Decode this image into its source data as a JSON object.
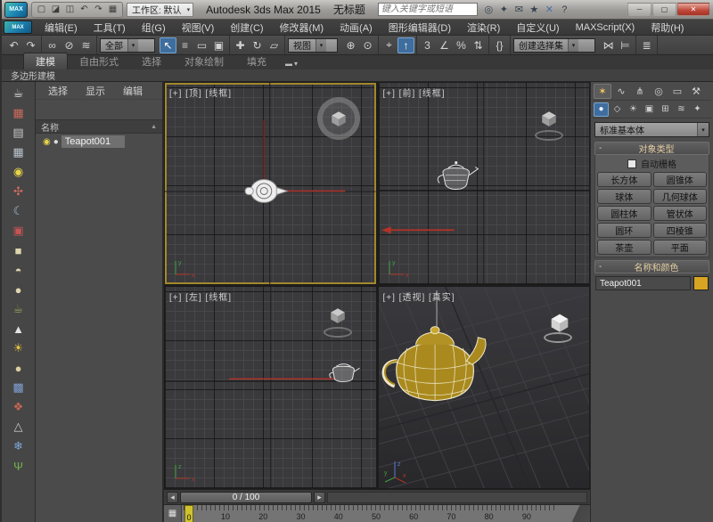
{
  "colors": {
    "accent_blue": "#3f6e9e",
    "active_viewport_border": "#a3872c",
    "teapot_gold": "#aa8a1e",
    "marker_yellow": "#cfc22e"
  },
  "glyphs": {
    "dropdown_arrow": "▾",
    "sort_asc": "▲",
    "slider_prev": "◂",
    "slider_next": "▸",
    "rollout_collapse": "-",
    "curve_editor": "▦",
    "ribbon_pill": "▬",
    "max_logo": "MAX",
    "strip_scroll": "▾",
    "minimize": "─",
    "maximize": "▢",
    "close": "✕"
  },
  "titlebar": {
    "workspace_label": "工作区: 默认",
    "app_title": "Autodesk 3ds Max  2015",
    "doc_title": "无标题",
    "search_placeholder": "键入关键字或短语",
    "qat": [
      {
        "name": "new-scene-icon",
        "glyph": "▢"
      },
      {
        "name": "open-file-icon",
        "glyph": "◪"
      },
      {
        "name": "save-file-icon",
        "glyph": "◫"
      },
      {
        "name": "undo-icon",
        "glyph": "↶"
      },
      {
        "name": "redo-icon",
        "glyph": "↷"
      },
      {
        "name": "project-folder-icon",
        "glyph": "▦"
      }
    ],
    "utility_icons": [
      {
        "name": "search-icon",
        "glyph": "◎"
      },
      {
        "name": "sign-in-key-icon",
        "glyph": "✦"
      },
      {
        "name": "communication-center-icon",
        "glyph": "✉"
      },
      {
        "name": "favorites-star-icon",
        "glyph": "★"
      },
      {
        "name": "a360-icon",
        "glyph": "✕",
        "color": "#4a6ea8"
      },
      {
        "name": "help-icon",
        "glyph": "?"
      }
    ]
  },
  "menubar": [
    "编辑(E)",
    "工具(T)",
    "组(G)",
    "视图(V)",
    "创建(C)",
    "修改器(M)",
    "动画(A)",
    "图形编辑器(D)",
    "渲染(R)",
    "自定义(U)",
    "MAXScript(X)",
    "帮助(H)"
  ],
  "toolbar": {
    "filter_value": "全部",
    "ref_value": "视图",
    "sets_value": "创建选择集",
    "g1": [
      {
        "name": "undo-icon",
        "glyph": "↶"
      },
      {
        "name": "redo-icon",
        "glyph": "↷"
      }
    ],
    "g2": [
      {
        "name": "select-and-link-icon",
        "glyph": "∞"
      },
      {
        "name": "unlink-selection-icon",
        "glyph": "⊘"
      },
      {
        "name": "bind-to-space-warp-icon",
        "glyph": "≋"
      }
    ],
    "g3": [
      {
        "name": "select-object-icon",
        "glyph": "↖",
        "active": true
      },
      {
        "name": "select-by-name-icon",
        "glyph": "≡"
      },
      {
        "name": "rectangular-selection-region-icon",
        "glyph": "▭"
      },
      {
        "name": "window-crossing-icon",
        "glyph": "▣"
      }
    ],
    "g4": [
      {
        "name": "select-and-move-icon",
        "glyph": "✚"
      },
      {
        "name": "select-and-rotate-icon",
        "glyph": "↻"
      },
      {
        "name": "select-and-scale-icon",
        "glyph": "▱"
      }
    ],
    "g5": [
      {
        "name": "use-pivot-point-icon",
        "glyph": "⊕"
      },
      {
        "name": "use-selection-center-icon",
        "glyph": "⊙"
      }
    ],
    "g6": [
      {
        "name": "select-and-manipulate-icon",
        "glyph": "⌖"
      },
      {
        "name": "keyboard-shortcut-override-icon",
        "glyph": "↑",
        "active": true
      }
    ],
    "g7": [
      {
        "name": "snap-toggle-3d-icon",
        "glyph": "3"
      },
      {
        "name": "angle-snap-icon",
        "glyph": "∠"
      },
      {
        "name": "percent-snap-icon",
        "glyph": "%"
      },
      {
        "name": "spinner-snap-icon",
        "glyph": "⇅"
      }
    ],
    "g8": [
      {
        "name": "edit-named-selection-sets-icon",
        "glyph": "{}"
      }
    ],
    "g9": [
      {
        "name": "mirror-icon",
        "glyph": "⋈"
      },
      {
        "name": "align-icon",
        "glyph": "⊨"
      }
    ],
    "g10": [
      {
        "name": "layer-manager-icon",
        "glyph": "≣"
      }
    ]
  },
  "ribbon": {
    "tabs": [
      {
        "label": "建模",
        "active": true
      },
      {
        "label": "自由形式"
      },
      {
        "label": "选择"
      },
      {
        "label": "对象绘制"
      },
      {
        "label": "填充"
      }
    ],
    "panel_label": "多边形建模"
  },
  "left_strip": {
    "icons": [
      {
        "name": "teapot-tool-icon",
        "glyph": "☕",
        "color": "#e9e9e9"
      },
      {
        "name": "render-preview-icon",
        "glyph": "▦",
        "color": "#c96a5a"
      },
      {
        "name": "list-panel-icon",
        "glyph": "▤",
        "color": "#c8c8c8"
      },
      {
        "name": "spreadsheet-icon",
        "glyph": "▦",
        "color": "#b9c2cc"
      },
      {
        "name": "light-bulb-icon",
        "glyph": "◉",
        "color": "#e6d44a"
      },
      {
        "name": "particle-fan-icon",
        "glyph": "✣",
        "color": "#cf6a5f"
      },
      {
        "name": "moon-icon",
        "glyph": "☾",
        "color": "#aebfd4"
      },
      {
        "name": "camera-icon",
        "glyph": "▣",
        "color": "#c75454"
      },
      {
        "name": "box-primitive-icon",
        "glyph": "■",
        "color": "#ddd6ae"
      },
      {
        "name": "dome-primitive-icon",
        "glyph": "◓",
        "color": "#ddd6ae"
      },
      {
        "name": "circle-primitive-icon",
        "glyph": "●",
        "color": "#ddd6ae"
      },
      {
        "name": "teapot-primitive-icon",
        "glyph": "☕",
        "color": "#9aa05a"
      },
      {
        "name": "cone-primitive-icon",
        "glyph": "▲",
        "color": "#e3e3e3"
      },
      {
        "name": "sun-icon",
        "glyph": "☀",
        "color": "#e8c43a"
      },
      {
        "name": "sphere-primitive-icon",
        "glyph": "●",
        "color": "#d9cf9f"
      },
      {
        "name": "checker-icon",
        "glyph": "▩",
        "color": "#7f9fd1"
      },
      {
        "name": "molecule-icon",
        "glyph": "❖",
        "color": "#c2654f"
      },
      {
        "name": "pyramid-icon",
        "glyph": "△",
        "color": "#c9c9c9"
      },
      {
        "name": "snowflake-icon",
        "glyph": "❄",
        "color": "#7ea8d8"
      },
      {
        "name": "grass-icon",
        "glyph": "Ψ",
        "color": "#6fae4e"
      }
    ]
  },
  "scene_explorer": {
    "menus": [
      "选择",
      "显示",
      "编辑"
    ],
    "name_column": "名称",
    "item": {
      "name": "Teapot001",
      "bulb": "◉",
      "dot": "●"
    }
  },
  "viewports": {
    "top_left": {
      "label": "[+] [顶] [线框]"
    },
    "top_right": {
      "label": "[+] [前] [线框]"
    },
    "bottom_left": {
      "label": "[+] [左] [线框]"
    },
    "bottom_right": {
      "label": "[+] [透视] [真实]"
    }
  },
  "command_panel": {
    "tabs": [
      {
        "name": "tab-create-icon",
        "glyph": "✶",
        "active": true
      },
      {
        "name": "tab-modify-icon",
        "glyph": "∿"
      },
      {
        "name": "tab-hierarchy-icon",
        "glyph": "⋔"
      },
      {
        "name": "tab-motion-icon",
        "glyph": "◎"
      },
      {
        "name": "tab-display-icon",
        "glyph": "▭"
      },
      {
        "name": "tab-utilities-icon",
        "glyph": "⚒"
      }
    ],
    "categories": [
      {
        "name": "cat-geometry-icon",
        "glyph": "●",
        "active": true
      },
      {
        "name": "cat-shapes-icon",
        "glyph": "◇"
      },
      {
        "name": "cat-lights-icon",
        "glyph": "☀"
      },
      {
        "name": "cat-cameras-icon",
        "glyph": "▣"
      },
      {
        "name": "cat-helpers-icon",
        "glyph": "⊞"
      },
      {
        "name": "cat-spacewarps-icon",
        "glyph": "≋"
      },
      {
        "name": "cat-systems-icon",
        "glyph": "✦"
      }
    ],
    "dropdown_value": "标准基本体",
    "object_type": {
      "title": "对象类型",
      "autogrid_label": "自动栅格",
      "buttons": [
        "长方体",
        "圆锥体",
        "球体",
        "几何球体",
        "圆柱体",
        "管状体",
        "圆环",
        "四棱锥",
        "茶壶",
        "平面"
      ]
    },
    "name_color": {
      "title": "名称和颜色",
      "name_value": "Teapot001",
      "color": "#D8A522"
    }
  },
  "timeline": {
    "frame_display": "0 / 100",
    "current_frame": "0",
    "tick_labels": [
      "10",
      "20",
      "30",
      "40",
      "50",
      "60",
      "70",
      "80",
      "90"
    ]
  }
}
